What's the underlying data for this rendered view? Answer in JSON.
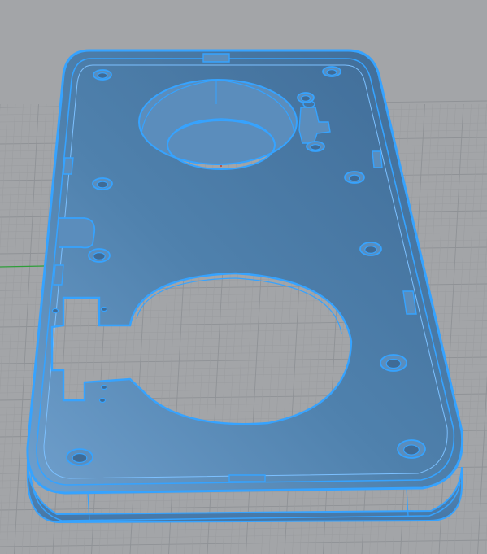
{
  "viewport": {
    "label": "",
    "background_color": "#a3a5a8",
    "grid_line_color": "#8f9296",
    "grid_minor_color": "#9a9c9f"
  },
  "axes": {
    "x_axis_color": "#c0392b",
    "y_axis_color": "#2e9e3a"
  },
  "model": {
    "fill_color": "#4f81ad",
    "fill_light": "#6f9fcc",
    "fill_dark": "#3c6690",
    "edge_highlight_color": "#36a3ff",
    "edge_inner_color": "#7cc0ff"
  }
}
